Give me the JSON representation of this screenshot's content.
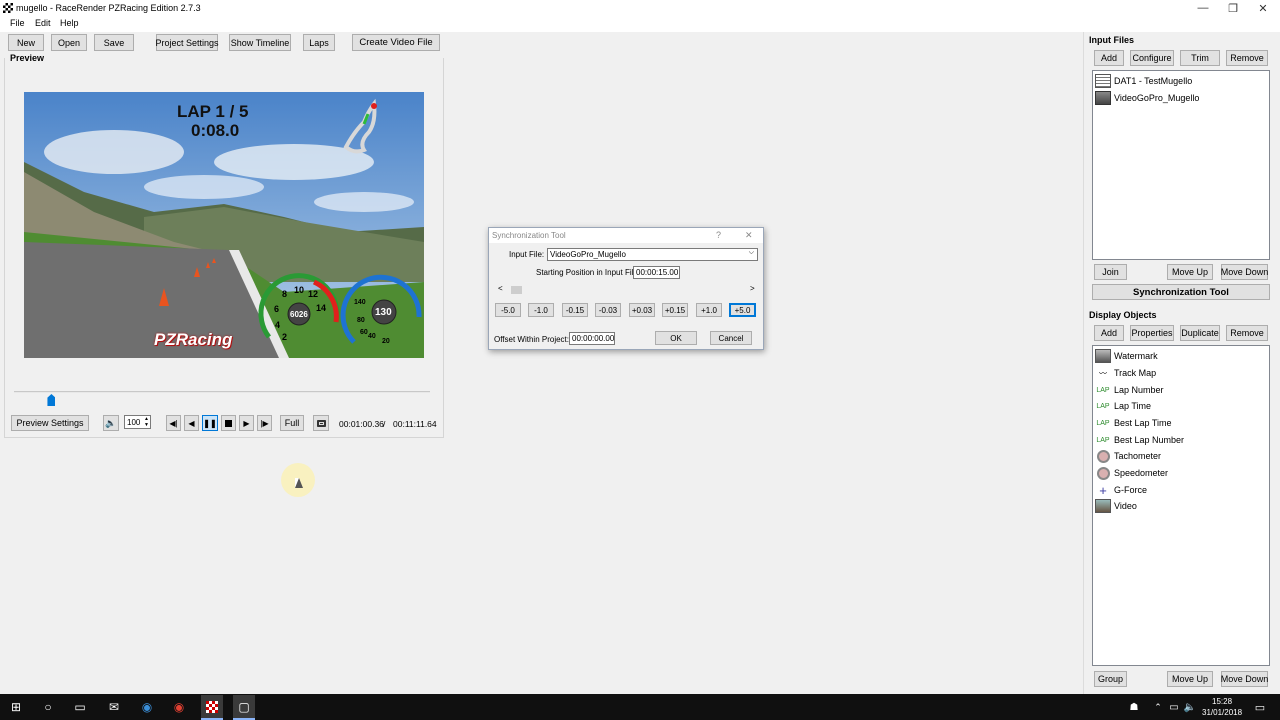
{
  "window": {
    "title": "mugello - RaceRender PZRacing Edition 2.7.3",
    "minimize": "—",
    "maximize": "❐",
    "close": "✕"
  },
  "menu": [
    "File",
    "Edit",
    "Help"
  ],
  "toolbar": {
    "new": "New",
    "open": "Open",
    "save": "Save",
    "project_settings": "Project Settings",
    "show_timeline": "Show Timeline",
    "laps": "Laps",
    "create_video": "Create Video File"
  },
  "preview": {
    "title": "Preview",
    "overlay_lap": "LAP 1 / 5",
    "overlay_time": "0:08.0",
    "logo_text": "PZRacing",
    "tacho_value": "6026",
    "speed_value": "130",
    "tacho_ticks": [
      "8",
      "10",
      "12",
      "14",
      "6",
      "4",
      "2"
    ],
    "speed_ticks": [
      "140",
      "80",
      "60",
      "40",
      "20"
    ],
    "position_fraction": 0.09
  },
  "controls": {
    "preview_settings": "Preview Settings",
    "volume": "100",
    "full": "Full",
    "current_time": "00:01:00.36",
    "separator": "/",
    "total_time": "00:11:11.64"
  },
  "input_files": {
    "title": "Input Files",
    "buttons": [
      "Add",
      "Configure",
      "Trim",
      "Remove"
    ],
    "items": [
      {
        "label": "DAT1 - TestMugello",
        "icon": "data-file-icon"
      },
      {
        "label": "VideoGoPro_Mugello",
        "icon": "video-file-icon"
      }
    ],
    "bottom_buttons": {
      "join": "Join",
      "move_up": "Move Up",
      "move_down": "Move Down"
    },
    "sync_tool": "Synchronization Tool"
  },
  "display_objects": {
    "title": "Display Objects",
    "buttons": [
      "Add",
      "Properties",
      "Duplicate",
      "Remove"
    ],
    "items": [
      {
        "label": "Watermark",
        "icon": "watermark-icon"
      },
      {
        "label": "Track Map",
        "icon": "track-map-icon"
      },
      {
        "label": "Lap Number",
        "icon": "lap-icon",
        "icon_text": "LAP"
      },
      {
        "label": "Lap Time",
        "icon": "lap-icon",
        "icon_text": "LAP"
      },
      {
        "label": "Best Lap Time",
        "icon": "lap-icon",
        "icon_text": "LAP"
      },
      {
        "label": "Best Lap Number",
        "icon": "lap-icon",
        "icon_text": "LAP"
      },
      {
        "label": "Tachometer",
        "icon": "gauge-icon"
      },
      {
        "label": "Speedometer",
        "icon": "gauge-icon"
      },
      {
        "label": "G-Force",
        "icon": "crosshair-icon"
      },
      {
        "label": "Video",
        "icon": "video-icon"
      }
    ],
    "bottom_buttons": {
      "group": "Group",
      "move_up": "Move Up",
      "move_down": "Move Down"
    }
  },
  "sync_dialog": {
    "title": "Synchronization Tool",
    "help": "?",
    "close": "✕",
    "input_file_label": "Input File:",
    "input_file_value": "VideoGoPro_Mugello",
    "start_pos_label": "Starting Position in Input File:",
    "start_pos_value": "00:00:15.00",
    "step_buttons": [
      "-5.0",
      "-1.0",
      "-0.15",
      "-0.03",
      "+0.03",
      "+0.15",
      "+1.0",
      "+5.0"
    ],
    "offset_label": "Offset Within Project:",
    "offset_value": "00:00:00.00",
    "ok": "OK",
    "cancel": "Cancel"
  },
  "taskbar": {
    "time": "15:28",
    "date": "31/01/2018"
  },
  "colors": {
    "accent": "#0078d7",
    "taskbar": "#101010",
    "gauge_red": "#e0201c",
    "gauge_blue": "#1e73d2"
  }
}
